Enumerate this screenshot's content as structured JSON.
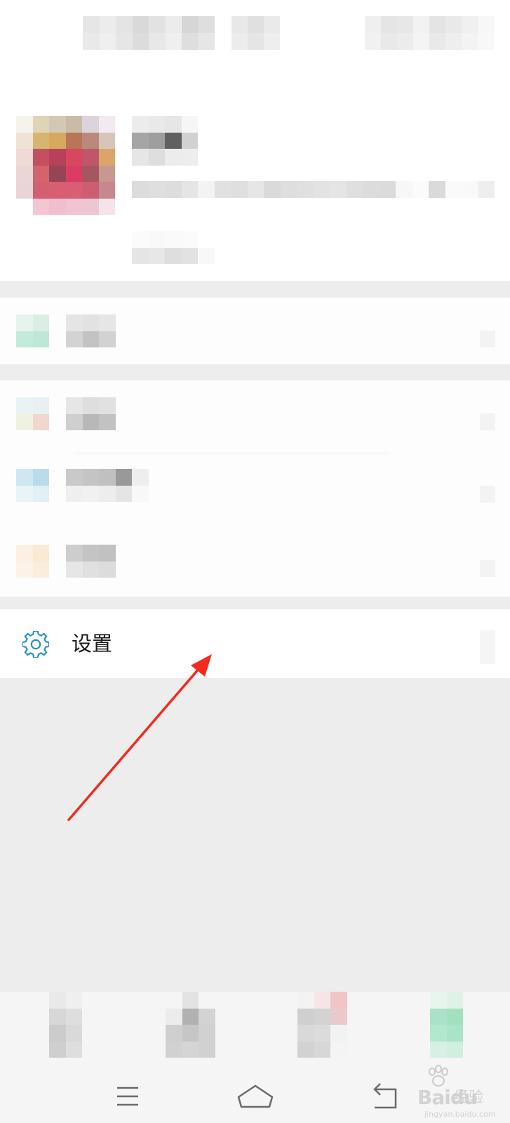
{
  "settings_item": {
    "label": "设置",
    "icon": "gear-icon",
    "icon_color": "#1e8fc4"
  },
  "annotation": {
    "arrow_color": "#f22b1d"
  },
  "navigation_bar": {
    "buttons": [
      "menu-icon",
      "home-icon",
      "back-icon"
    ]
  },
  "watermark": {
    "logo": "Bai",
    "logo_suffix": "du",
    "text": "经验",
    "url": "jingyan.baidu.com"
  }
}
